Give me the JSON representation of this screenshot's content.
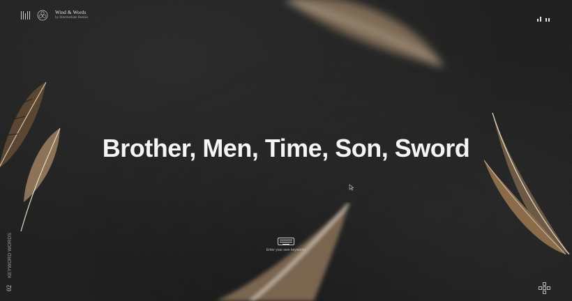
{
  "brand": {
    "title": "Wind & Words",
    "subtitle": "by Intermediate Besties"
  },
  "headline": "Brother, Men, Time, Son, Sword",
  "keyboard_hint": "Enter your own keywords",
  "side_label": {
    "number": "02",
    "text": "KEYWORD WORDS"
  },
  "icons": {
    "sound": "sound-bars-icon",
    "logo": "flower-logo-icon",
    "keyboard": "keyboard-icon",
    "controls": "arrow-keys-icon",
    "cursor": "mouse-cursor-icon"
  },
  "colors": {
    "background": "#171717",
    "text": "#f5f5f5",
    "feather": "#8a6b4a"
  }
}
